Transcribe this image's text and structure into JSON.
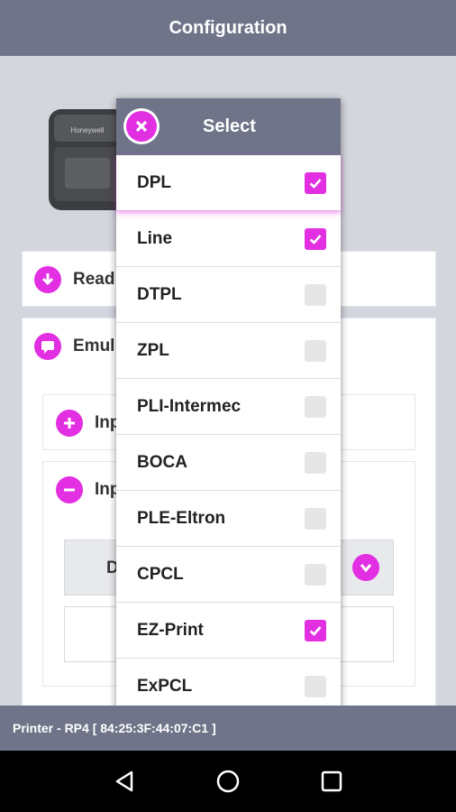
{
  "app_bar": {
    "title": "Configuration"
  },
  "background": {
    "printer_brand": "Honeywell",
    "rows": {
      "read_label": "Read",
      "emulation_label": "Emul",
      "input1_label": "Inp",
      "input2_label": "Inp",
      "dropdown_partial": "D"
    }
  },
  "dialog": {
    "title": "Select",
    "options": [
      {
        "label": "DPL",
        "checked": true
      },
      {
        "label": "Line",
        "checked": true
      },
      {
        "label": "DTPL",
        "checked": false
      },
      {
        "label": "ZPL",
        "checked": false
      },
      {
        "label": "PLI-Intermec",
        "checked": false
      },
      {
        "label": "BOCA",
        "checked": false
      },
      {
        "label": "PLE-Eltron",
        "checked": false
      },
      {
        "label": "CPCL",
        "checked": false
      },
      {
        "label": "EZ-Print",
        "checked": true
      },
      {
        "label": "ExPCL",
        "checked": false
      }
    ]
  },
  "status": {
    "text": "Printer - RP4 [ 84:25:3F:44:07:C1 ]"
  },
  "colors": {
    "accent": "#e22fe2",
    "bar": "#6f7489"
  },
  "icons": {
    "back": "back-triangle-icon",
    "home": "home-circle-icon",
    "recents": "recents-square-icon"
  }
}
